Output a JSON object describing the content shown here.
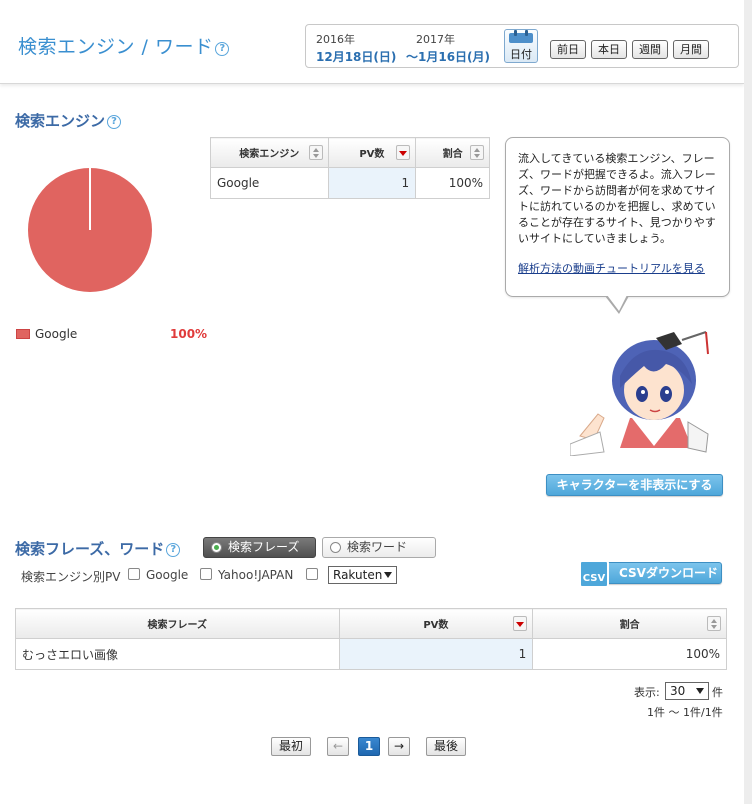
{
  "header": {
    "title": "検索エンジン / ワード",
    "start_year": "2016年",
    "start_date": "12月18日(日)",
    "end_year": "2017年",
    "end_date": "〜1月16日(月)",
    "calendar_label": "日付",
    "period_buttons": [
      "前日",
      "本日",
      "週間",
      "月間"
    ]
  },
  "engine_section": {
    "title": "検索エンジン",
    "table": {
      "columns": [
        "検索エンジン",
        "PV数",
        "割合"
      ],
      "rows": [
        {
          "engine": "Google",
          "pv": "1",
          "ratio": "100%"
        }
      ]
    },
    "legend": [
      {
        "label": "Google",
        "pct": "100%",
        "color": "#e06460"
      }
    ]
  },
  "chart_data": {
    "type": "pie",
    "labels": [
      "Google"
    ],
    "values": [
      100
    ],
    "colors": [
      "#e06460"
    ],
    "title": ""
  },
  "assistant": {
    "message": "流入してきている検索エンジン、フレーズ、ワードが把握できるよ。流入フレーズ、ワードから訪問者が何を求めてサイトに訪れているのかを把握し、求めていることが存在するサイト、見つかりやすいサイトにしていきましょう。",
    "link": "解析方法の動画チュートリアルを見る",
    "hide_button": "キャラクターを非表示にする"
  },
  "phrase_section": {
    "title": "検索フレーズ、ワード",
    "toggle_phrase": "検索フレーズ",
    "toggle_word": "検索ワード",
    "filter_label": "検索エンジン別PV",
    "filters": [
      "Google",
      "Yahoo!JAPAN"
    ],
    "extra_select": "Rakuten",
    "csv_icon_text": "CSV",
    "csv_button": "CSVダウンロード",
    "table": {
      "columns": [
        "検索フレーズ",
        "PV数",
        "割合"
      ],
      "rows": [
        {
          "phrase": "むっさエロい画像",
          "pv": "1",
          "ratio": "100%"
        }
      ]
    },
    "display_label": "表示:",
    "per_page": "30",
    "unit": "件",
    "range": "1件 〜 1件/1件"
  },
  "pager": {
    "first": "最初",
    "prev": "←",
    "current": "1",
    "next": "→",
    "last": "最後"
  }
}
